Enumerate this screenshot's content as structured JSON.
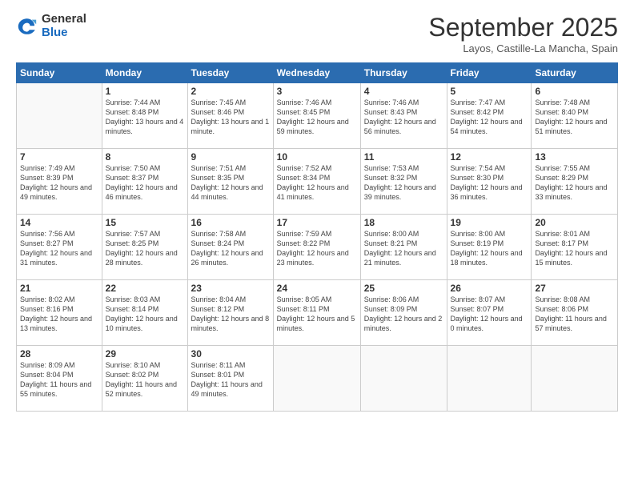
{
  "logo": {
    "general": "General",
    "blue": "Blue"
  },
  "header": {
    "title": "September 2025",
    "subtitle": "Layos, Castille-La Mancha, Spain"
  },
  "weekdays": [
    "Sunday",
    "Monday",
    "Tuesday",
    "Wednesday",
    "Thursday",
    "Friday",
    "Saturday"
  ],
  "weeks": [
    [
      {
        "day": "",
        "sunrise": "",
        "sunset": "",
        "daylight": ""
      },
      {
        "day": "1",
        "sunrise": "Sunrise: 7:44 AM",
        "sunset": "Sunset: 8:48 PM",
        "daylight": "Daylight: 13 hours and 4 minutes."
      },
      {
        "day": "2",
        "sunrise": "Sunrise: 7:45 AM",
        "sunset": "Sunset: 8:46 PM",
        "daylight": "Daylight: 13 hours and 1 minute."
      },
      {
        "day": "3",
        "sunrise": "Sunrise: 7:46 AM",
        "sunset": "Sunset: 8:45 PM",
        "daylight": "Daylight: 12 hours and 59 minutes."
      },
      {
        "day": "4",
        "sunrise": "Sunrise: 7:46 AM",
        "sunset": "Sunset: 8:43 PM",
        "daylight": "Daylight: 12 hours and 56 minutes."
      },
      {
        "day": "5",
        "sunrise": "Sunrise: 7:47 AM",
        "sunset": "Sunset: 8:42 PM",
        "daylight": "Daylight: 12 hours and 54 minutes."
      },
      {
        "day": "6",
        "sunrise": "Sunrise: 7:48 AM",
        "sunset": "Sunset: 8:40 PM",
        "daylight": "Daylight: 12 hours and 51 minutes."
      }
    ],
    [
      {
        "day": "7",
        "sunrise": "Sunrise: 7:49 AM",
        "sunset": "Sunset: 8:39 PM",
        "daylight": "Daylight: 12 hours and 49 minutes."
      },
      {
        "day": "8",
        "sunrise": "Sunrise: 7:50 AM",
        "sunset": "Sunset: 8:37 PM",
        "daylight": "Daylight: 12 hours and 46 minutes."
      },
      {
        "day": "9",
        "sunrise": "Sunrise: 7:51 AM",
        "sunset": "Sunset: 8:35 PM",
        "daylight": "Daylight: 12 hours and 44 minutes."
      },
      {
        "day": "10",
        "sunrise": "Sunrise: 7:52 AM",
        "sunset": "Sunset: 8:34 PM",
        "daylight": "Daylight: 12 hours and 41 minutes."
      },
      {
        "day": "11",
        "sunrise": "Sunrise: 7:53 AM",
        "sunset": "Sunset: 8:32 PM",
        "daylight": "Daylight: 12 hours and 39 minutes."
      },
      {
        "day": "12",
        "sunrise": "Sunrise: 7:54 AM",
        "sunset": "Sunset: 8:30 PM",
        "daylight": "Daylight: 12 hours and 36 minutes."
      },
      {
        "day": "13",
        "sunrise": "Sunrise: 7:55 AM",
        "sunset": "Sunset: 8:29 PM",
        "daylight": "Daylight: 12 hours and 33 minutes."
      }
    ],
    [
      {
        "day": "14",
        "sunrise": "Sunrise: 7:56 AM",
        "sunset": "Sunset: 8:27 PM",
        "daylight": "Daylight: 12 hours and 31 minutes."
      },
      {
        "day": "15",
        "sunrise": "Sunrise: 7:57 AM",
        "sunset": "Sunset: 8:25 PM",
        "daylight": "Daylight: 12 hours and 28 minutes."
      },
      {
        "day": "16",
        "sunrise": "Sunrise: 7:58 AM",
        "sunset": "Sunset: 8:24 PM",
        "daylight": "Daylight: 12 hours and 26 minutes."
      },
      {
        "day": "17",
        "sunrise": "Sunrise: 7:59 AM",
        "sunset": "Sunset: 8:22 PM",
        "daylight": "Daylight: 12 hours and 23 minutes."
      },
      {
        "day": "18",
        "sunrise": "Sunrise: 8:00 AM",
        "sunset": "Sunset: 8:21 PM",
        "daylight": "Daylight: 12 hours and 21 minutes."
      },
      {
        "day": "19",
        "sunrise": "Sunrise: 8:00 AM",
        "sunset": "Sunset: 8:19 PM",
        "daylight": "Daylight: 12 hours and 18 minutes."
      },
      {
        "day": "20",
        "sunrise": "Sunrise: 8:01 AM",
        "sunset": "Sunset: 8:17 PM",
        "daylight": "Daylight: 12 hours and 15 minutes."
      }
    ],
    [
      {
        "day": "21",
        "sunrise": "Sunrise: 8:02 AM",
        "sunset": "Sunset: 8:16 PM",
        "daylight": "Daylight: 12 hours and 13 minutes."
      },
      {
        "day": "22",
        "sunrise": "Sunrise: 8:03 AM",
        "sunset": "Sunset: 8:14 PM",
        "daylight": "Daylight: 12 hours and 10 minutes."
      },
      {
        "day": "23",
        "sunrise": "Sunrise: 8:04 AM",
        "sunset": "Sunset: 8:12 PM",
        "daylight": "Daylight: 12 hours and 8 minutes."
      },
      {
        "day": "24",
        "sunrise": "Sunrise: 8:05 AM",
        "sunset": "Sunset: 8:11 PM",
        "daylight": "Daylight: 12 hours and 5 minutes."
      },
      {
        "day": "25",
        "sunrise": "Sunrise: 8:06 AM",
        "sunset": "Sunset: 8:09 PM",
        "daylight": "Daylight: 12 hours and 2 minutes."
      },
      {
        "day": "26",
        "sunrise": "Sunrise: 8:07 AM",
        "sunset": "Sunset: 8:07 PM",
        "daylight": "Daylight: 12 hours and 0 minutes."
      },
      {
        "day": "27",
        "sunrise": "Sunrise: 8:08 AM",
        "sunset": "Sunset: 8:06 PM",
        "daylight": "Daylight: 11 hours and 57 minutes."
      }
    ],
    [
      {
        "day": "28",
        "sunrise": "Sunrise: 8:09 AM",
        "sunset": "Sunset: 8:04 PM",
        "daylight": "Daylight: 11 hours and 55 minutes."
      },
      {
        "day": "29",
        "sunrise": "Sunrise: 8:10 AM",
        "sunset": "Sunset: 8:02 PM",
        "daylight": "Daylight: 11 hours and 52 minutes."
      },
      {
        "day": "30",
        "sunrise": "Sunrise: 8:11 AM",
        "sunset": "Sunset: 8:01 PM",
        "daylight": "Daylight: 11 hours and 49 minutes."
      },
      {
        "day": "",
        "sunrise": "",
        "sunset": "",
        "daylight": ""
      },
      {
        "day": "",
        "sunrise": "",
        "sunset": "",
        "daylight": ""
      },
      {
        "day": "",
        "sunrise": "",
        "sunset": "",
        "daylight": ""
      },
      {
        "day": "",
        "sunrise": "",
        "sunset": "",
        "daylight": ""
      }
    ]
  ]
}
